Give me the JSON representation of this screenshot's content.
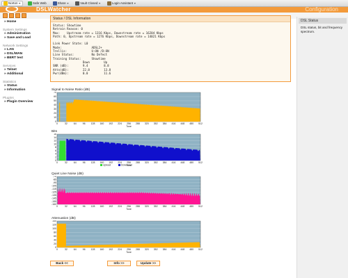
{
  "toolbar": {
    "items": [
      {
        "label": "Norton",
        "icon": "norton-check-icon"
      },
      {
        "label": "Safe Web",
        "icon": "safe-web-icon"
      },
      {
        "label": "Share",
        "icon": "facebook-icon"
      },
      {
        "label": "Vault Closed",
        "icon": "vault-icon"
      },
      {
        "label": "Login Assistant",
        "icon": "login-icon"
      }
    ]
  },
  "header": {
    "brand": "DSLWatcher",
    "subtitle": "Configuration"
  },
  "sidebar": {
    "top": [
      {
        "label": "Home"
      }
    ],
    "sections": [
      {
        "heading": "System Settings",
        "items": [
          {
            "label": "Administration"
          },
          {
            "label": "Save and Load"
          }
        ]
      },
      {
        "heading": "Network Settings",
        "items": [
          {
            "label": "LAN"
          },
          {
            "label": "DSL/WAN"
          },
          {
            "label": "BERT test"
          }
        ]
      },
      {
        "heading": "Services",
        "items": [
          {
            "label": "Telnet"
          },
          {
            "label": "Additional"
          }
        ]
      },
      {
        "heading": "Statistics",
        "items": [
          {
            "label": "Status"
          },
          {
            "label": "Information"
          }
        ]
      },
      {
        "heading": "Plugins",
        "items": [
          {
            "label": "Plugin Overview"
          }
        ]
      }
    ]
  },
  "help": {
    "title": "DSL Status",
    "text": "DSL status, bit and frequency spectrum."
  },
  "status": {
    "title": "Status / DSL Information",
    "text": "Status: Showtime\nRetrain Reason: 0\nMax:    Upstream rate = 1316 Kbps, Downstream rate = 16204 Kbps\nPath: 0, Upstream rate = 1276 Kbps, Downstream rate = 14021 Kbps\n\nLink Power State: L0\nMode:                 ADSL2+\nTrellis:              U:ON /D:ON\nLine Status:          No Defect\nTraining Status:      Showtime\n                 Down        Up\nSNR (dB):        9.4         8.8\nAttn(dB):        22.8        13.8\nPwr(dBm):        0.0         11.6"
  },
  "charts": {
    "x_label": "Tone",
    "x_ticks": [
      "0",
      "32",
      "64",
      "96",
      "128",
      "160",
      "192",
      "224",
      "256",
      "288",
      "320",
      "352",
      "384",
      "416",
      "448",
      "480",
      "512"
    ],
    "snr": {
      "title": "Signal to Noise Ratio (dB)",
      "y_ticks": [
        "70",
        "60",
        "50",
        "40",
        "30",
        "20",
        "10",
        "0"
      ],
      "color": "#ffb300",
      "bg": "#8fb2c4"
    },
    "bits": {
      "title": "Bits",
      "y_ticks": [
        "16",
        "14",
        "12",
        "10",
        "8",
        "6",
        "4",
        "2",
        "0"
      ],
      "up_color": "#33dd33",
      "down_color": "#1010cc",
      "legend": [
        {
          "label": "Upload",
          "color": "#33dd33"
        },
        {
          "label": "Download",
          "color": "#1010cc"
        }
      ]
    },
    "qln": {
      "title": "Quiet Line Noise (dB)",
      "y_ticks": [
        "-70",
        "-85",
        "-95",
        "-105",
        "-115",
        "-125",
        "-135",
        "-145",
        "-155",
        "-160"
      ],
      "color": "#ff1493"
    },
    "attn": {
      "title": "Attenuation (dB)",
      "y_ticks": [
        "140",
        "120",
        "100",
        "80",
        "60",
        "40",
        "20",
        "0"
      ],
      "color": "#ffb300"
    }
  },
  "buttons": {
    "back": "Back <<",
    "info": "Info >>",
    "update": "Update >>"
  }
}
